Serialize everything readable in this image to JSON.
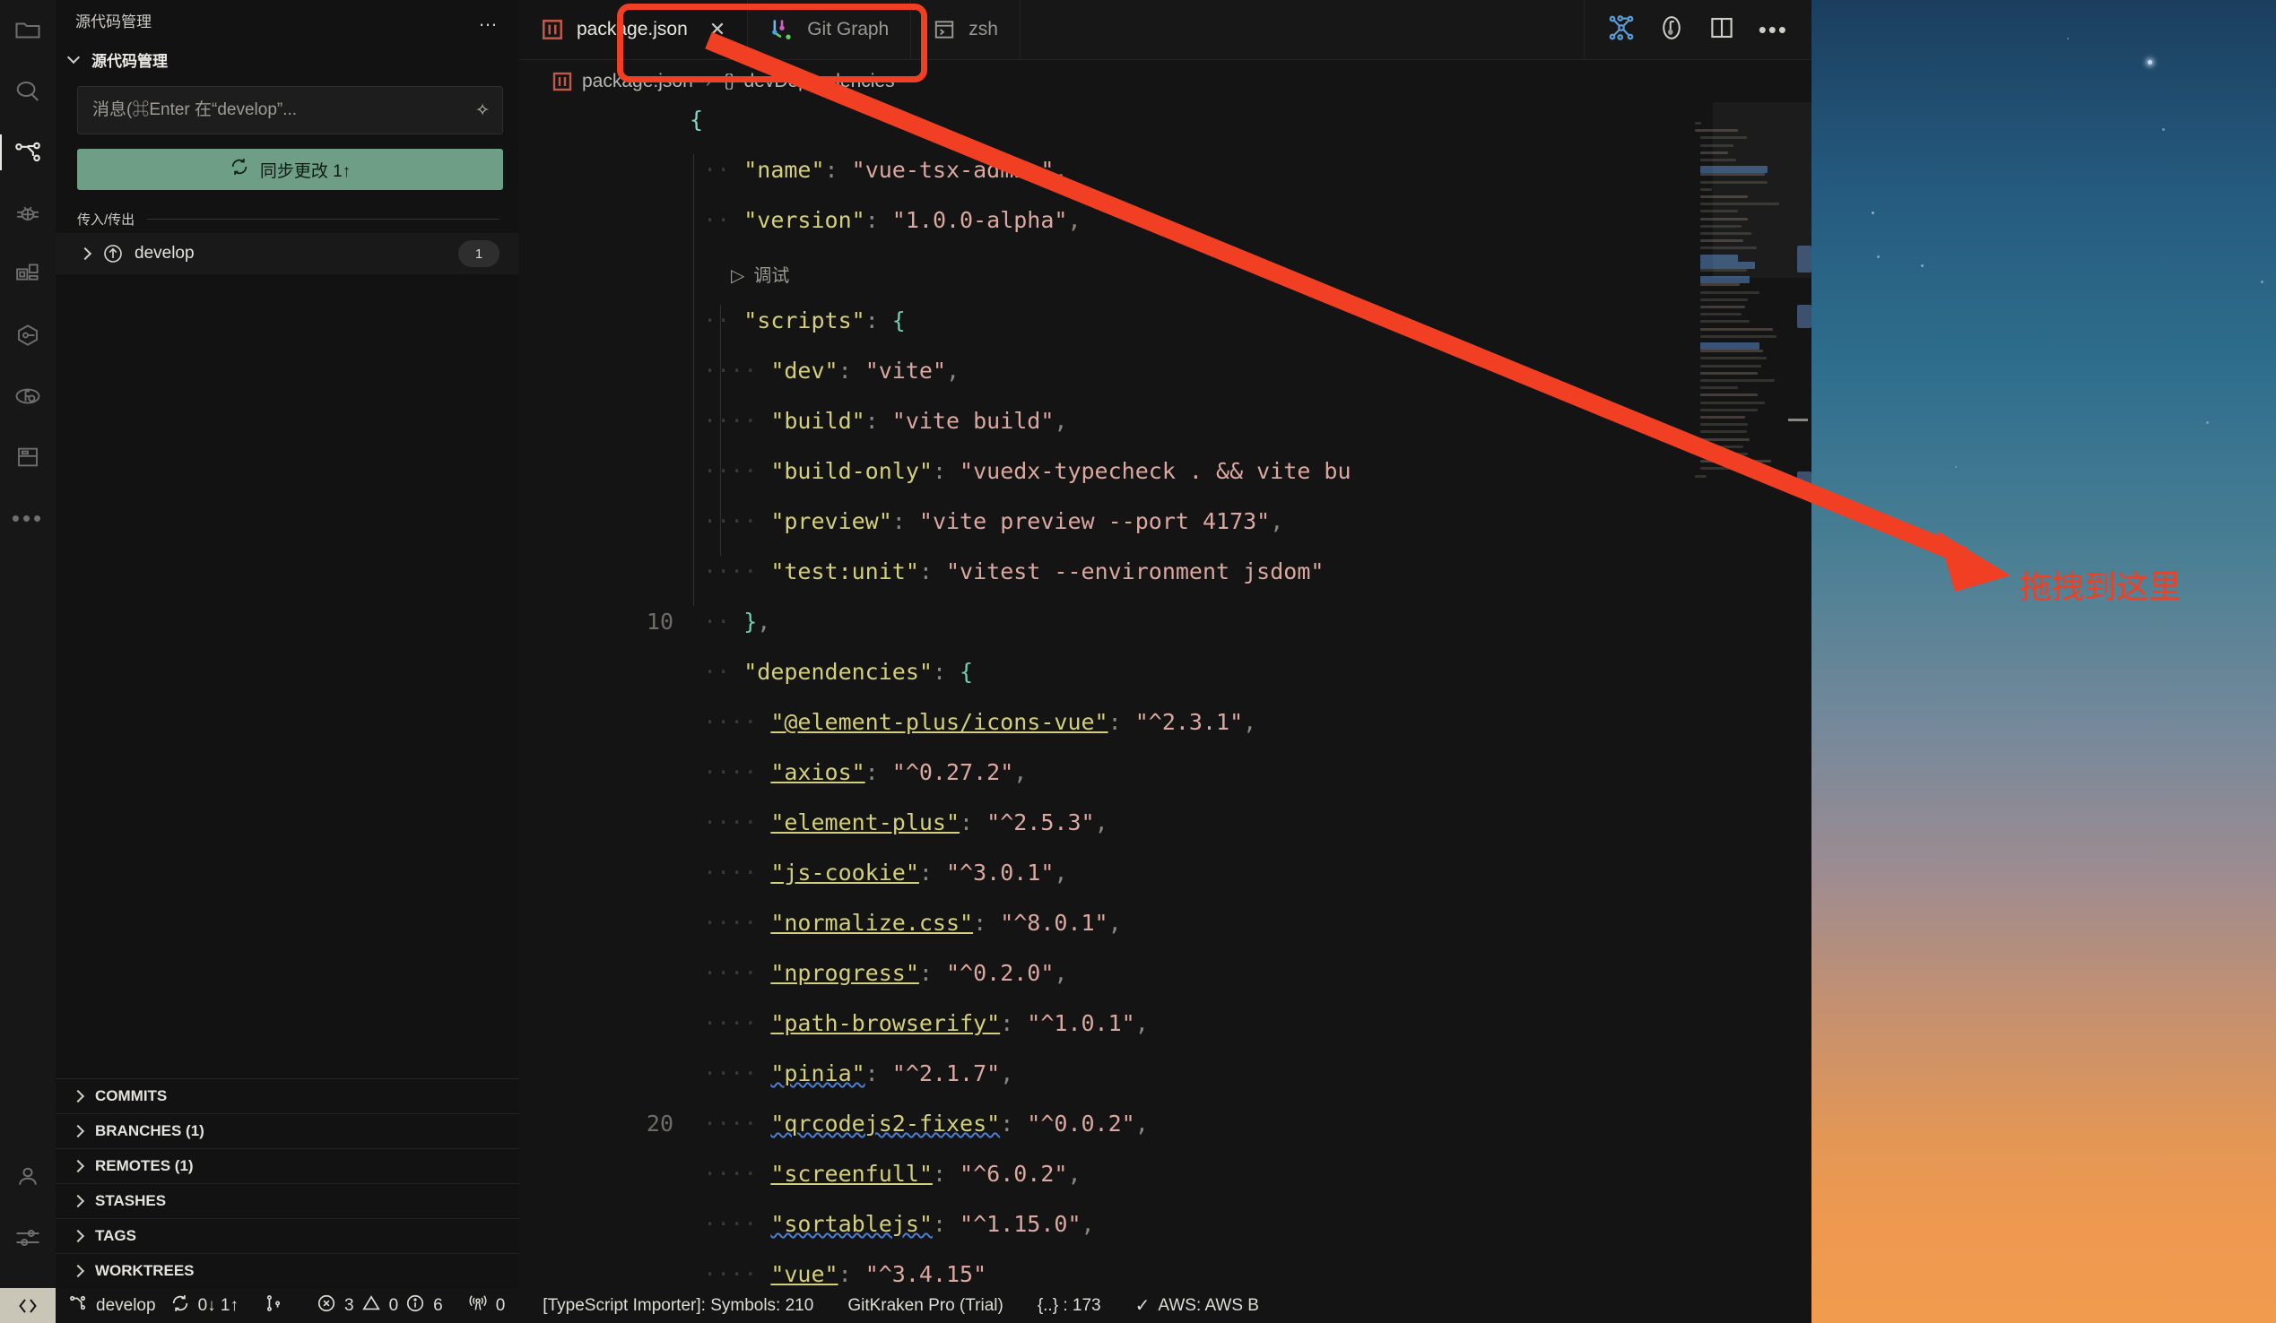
{
  "activity_bar": {
    "items": [
      {
        "name": "explorer",
        "icon": "folder-icon",
        "active": false
      },
      {
        "name": "search",
        "icon": "search-icon",
        "active": false
      },
      {
        "name": "source-control",
        "icon": "source-control-icon",
        "active": true
      },
      {
        "name": "run-and-debug",
        "icon": "bug-icon",
        "active": false
      },
      {
        "name": "extensions",
        "icon": "extensions-icon",
        "active": false
      },
      {
        "name": "package-manager",
        "icon": "hexagon-key-icon",
        "active": false
      },
      {
        "name": "gitlens",
        "icon": "gitlens-icon",
        "active": false
      },
      {
        "name": "database",
        "icon": "archive-icon",
        "active": false
      },
      {
        "name": "more",
        "icon": "ellipsis-icon",
        "active": false
      }
    ],
    "bottom_items": [
      {
        "name": "accounts",
        "icon": "account-icon"
      },
      {
        "name": "manage",
        "icon": "settings-gear-icon"
      }
    ]
  },
  "sidebar": {
    "title": "源代码管理",
    "more_actions": "…",
    "section_title": "源代码管理",
    "commit_input": {
      "value": "",
      "placeholder": "消息(⌘Enter 在“develop”...",
      "sparkle_icon": "sparkle-icon"
    },
    "sync_button": {
      "label": "同步更改 1↑",
      "icon": "sync-icon",
      "color": "#6e9e85"
    },
    "incoming_outgoing": {
      "label": "传入/传出",
      "items": [
        {
          "label": "develop",
          "badge": "1",
          "icon": "outgoing-arrow-icon"
        }
      ]
    },
    "accordion": [
      {
        "label": "COMMITS"
      },
      {
        "label": "BRANCHES (1)"
      },
      {
        "label": "REMOTES (1)"
      },
      {
        "label": "STASHES"
      },
      {
        "label": "TAGS"
      },
      {
        "label": "WORKTREES"
      }
    ]
  },
  "editor": {
    "tabs": [
      {
        "label": "package.json",
        "icon": "json-file-icon",
        "active": true,
        "close": "✕"
      },
      {
        "label": "Git Graph",
        "icon": "git-graph-icon",
        "active": false
      },
      {
        "label": "zsh",
        "icon": "terminal-icon",
        "active": false
      }
    ],
    "tab_actions": [
      {
        "name": "git-graph-action",
        "icon": "graph-icon"
      },
      {
        "name": "gitlens-action",
        "icon": "gitlens-icon"
      },
      {
        "name": "split-editor-action",
        "icon": "split-editor-icon"
      },
      {
        "name": "more-actions",
        "icon": "ellipsis-icon"
      }
    ],
    "breadcrumb": {
      "file_icon": "json-file-icon",
      "file": "package.json",
      "separator": "›",
      "brace": "{}",
      "symbol": "devDependencies"
    },
    "codelens": {
      "icon": "play-icon",
      "label": "调试"
    },
    "gutter_labels": [
      "10",
      "20"
    ],
    "code_lines": [
      {
        "line": 1,
        "indent": 0,
        "tokens": [
          {
            "t": "{",
            "c": "b"
          }
        ]
      },
      {
        "line": 2,
        "indent": 1,
        "tokens": [
          {
            "t": "\"name\"",
            "c": "k"
          },
          {
            "t": ": ",
            "c": "p"
          },
          {
            "t": "\"vue-tsx-admin\"",
            "c": "s"
          },
          {
            "t": ",",
            "c": "p"
          }
        ]
      },
      {
        "line": 3,
        "indent": 1,
        "tokens": [
          {
            "t": "\"version\"",
            "c": "k"
          },
          {
            "t": ": ",
            "c": "p"
          },
          {
            "t": "\"1.0.0-alpha\"",
            "c": "s"
          },
          {
            "t": ",",
            "c": "p"
          }
        ]
      },
      {
        "line": 4,
        "indent": 1,
        "tokens": [
          {
            "t": "\"scripts\"",
            "c": "k"
          },
          {
            "t": ": ",
            "c": "p"
          },
          {
            "t": "{",
            "c": "b2"
          }
        ]
      },
      {
        "line": 5,
        "indent": 2,
        "tokens": [
          {
            "t": "\"dev\"",
            "c": "k"
          },
          {
            "t": ": ",
            "c": "p"
          },
          {
            "t": "\"vite\"",
            "c": "s"
          },
          {
            "t": ",",
            "c": "p"
          }
        ]
      },
      {
        "line": 6,
        "indent": 2,
        "tokens": [
          {
            "t": "\"build\"",
            "c": "k"
          },
          {
            "t": ": ",
            "c": "p"
          },
          {
            "t": "\"vite build\"",
            "c": "s"
          },
          {
            "t": ",",
            "c": "p"
          }
        ]
      },
      {
        "line": 7,
        "indent": 2,
        "tokens": [
          {
            "t": "\"build-only\"",
            "c": "k"
          },
          {
            "t": ": ",
            "c": "p"
          },
          {
            "t": "\"vuedx-typecheck . && vite bu",
            "c": "s"
          }
        ]
      },
      {
        "line": 8,
        "indent": 2,
        "tokens": [
          {
            "t": "\"preview\"",
            "c": "k"
          },
          {
            "t": ": ",
            "c": "p"
          },
          {
            "t": "\"vite preview --port 4173\"",
            "c": "s"
          },
          {
            "t": ",",
            "c": "p"
          }
        ]
      },
      {
        "line": 9,
        "indent": 2,
        "tokens": [
          {
            "t": "\"test:unit\"",
            "c": "k"
          },
          {
            "t": ": ",
            "c": "p"
          },
          {
            "t": "\"vitest --environment jsdom\"",
            "c": "s"
          }
        ]
      },
      {
        "line": 10,
        "indent": 1,
        "tokens": [
          {
            "t": "}",
            "c": "b2"
          },
          {
            "t": ",",
            "c": "p"
          }
        ]
      },
      {
        "line": 11,
        "indent": 1,
        "tokens": [
          {
            "t": "\"dependencies\"",
            "c": "k"
          },
          {
            "t": ": ",
            "c": "p"
          },
          {
            "t": "{",
            "c": "b2"
          }
        ]
      },
      {
        "line": 12,
        "indent": 2,
        "tokens": [
          {
            "t": "\"@element-plus/icons-vue\"",
            "c": "k lnk"
          },
          {
            "t": ": ",
            "c": "p"
          },
          {
            "t": "\"^2.3.1\"",
            "c": "s"
          },
          {
            "t": ",",
            "c": "p"
          }
        ]
      },
      {
        "line": 13,
        "indent": 2,
        "tokens": [
          {
            "t": "\"axios\"",
            "c": "k lnk"
          },
          {
            "t": ": ",
            "c": "p"
          },
          {
            "t": "\"^0.27.2\"",
            "c": "s"
          },
          {
            "t": ",",
            "c": "p"
          }
        ]
      },
      {
        "line": 14,
        "indent": 2,
        "tokens": [
          {
            "t": "\"element-plus\"",
            "c": "k lnk"
          },
          {
            "t": ": ",
            "c": "p"
          },
          {
            "t": "\"^2.5.3\"",
            "c": "s"
          },
          {
            "t": ",",
            "c": "p"
          }
        ]
      },
      {
        "line": 15,
        "indent": 2,
        "tokens": [
          {
            "t": "\"js-cookie\"",
            "c": "k lnk"
          },
          {
            "t": ": ",
            "c": "p"
          },
          {
            "t": "\"^3.0.1\"",
            "c": "s"
          },
          {
            "t": ",",
            "c": "p"
          }
        ]
      },
      {
        "line": 16,
        "indent": 2,
        "tokens": [
          {
            "t": "\"normalize.css\"",
            "c": "k lnk"
          },
          {
            "t": ": ",
            "c": "p"
          },
          {
            "t": "\"^8.0.1\"",
            "c": "s"
          },
          {
            "t": ",",
            "c": "p"
          }
        ]
      },
      {
        "line": 17,
        "indent": 2,
        "tokens": [
          {
            "t": "\"nprogress\"",
            "c": "k lnk"
          },
          {
            "t": ": ",
            "c": "p"
          },
          {
            "t": "\"^0.2.0\"",
            "c": "s"
          },
          {
            "t": ",",
            "c": "p"
          }
        ]
      },
      {
        "line": 18,
        "indent": 2,
        "tokens": [
          {
            "t": "\"path-browserify\"",
            "c": "k lnk"
          },
          {
            "t": ": ",
            "c": "p"
          },
          {
            "t": "\"^1.0.1\"",
            "c": "s"
          },
          {
            "t": ",",
            "c": "p"
          }
        ]
      },
      {
        "line": 19,
        "indent": 2,
        "tokens": [
          {
            "t": "\"pinia\"",
            "c": "k lnk sq"
          },
          {
            "t": ": ",
            "c": "p"
          },
          {
            "t": "\"^2.1.7\"",
            "c": "s"
          },
          {
            "t": ",",
            "c": "p"
          }
        ]
      },
      {
        "line": 20,
        "indent": 2,
        "tokens": [
          {
            "t": "\"qrcodejs2-fixes\"",
            "c": "k lnk sq"
          },
          {
            "t": ": ",
            "c": "p"
          },
          {
            "t": "\"^0.0.2\"",
            "c": "s"
          },
          {
            "t": ",",
            "c": "p"
          }
        ]
      },
      {
        "line": 21,
        "indent": 2,
        "tokens": [
          {
            "t": "\"screenfull\"",
            "c": "k lnk"
          },
          {
            "t": ": ",
            "c": "p"
          },
          {
            "t": "\"^6.0.2\"",
            "c": "s"
          },
          {
            "t": ",",
            "c": "p"
          }
        ]
      },
      {
        "line": 22,
        "indent": 2,
        "tokens": [
          {
            "t": "\"sortablejs\"",
            "c": "k lnk sq"
          },
          {
            "t": ": ",
            "c": "p"
          },
          {
            "t": "\"^1.15.0\"",
            "c": "s"
          },
          {
            "t": ",",
            "c": "p"
          }
        ]
      },
      {
        "line": 23,
        "indent": 2,
        "tokens": [
          {
            "t": "\"vue\"",
            "c": "k lnk"
          },
          {
            "t": ": ",
            "c": "p"
          },
          {
            "t": "\"^3.4.15\"",
            "c": "s"
          }
        ]
      }
    ]
  },
  "status_bar": {
    "remote_icon": "remote-window-icon",
    "items": [
      {
        "name": "branch",
        "icon": "branch-icon",
        "label": "develop"
      },
      {
        "name": "sync",
        "icon": "sync-icon",
        "label": "0↓ 1↑"
      },
      {
        "name": "pull-request",
        "icon": "pull-request-icon",
        "label": ""
      },
      {
        "name": "errors",
        "icon": "error-icon",
        "label": "3"
      },
      {
        "name": "warnings",
        "icon": "warning-icon",
        "label": "0"
      },
      {
        "name": "infos",
        "icon": "info-icon",
        "label": "6"
      },
      {
        "name": "radio-tower",
        "icon": "radio-tower-icon",
        "label": "0"
      },
      {
        "name": "typescript-importer",
        "icon": "",
        "label": "[TypeScript Importer]: Symbols: 210"
      },
      {
        "name": "gitkraken",
        "icon": "",
        "label": "GitKraken Pro (Trial)"
      },
      {
        "name": "json-symbols",
        "icon": "",
        "label": "{..} : 173"
      },
      {
        "name": "aws",
        "icon": "check-icon",
        "label": "AWS: AWS B"
      }
    ]
  },
  "annotations": {
    "highlight_box_target": "package.json tab",
    "arrow_label": "拖拽到这里",
    "accent_color": "#f03f22"
  }
}
